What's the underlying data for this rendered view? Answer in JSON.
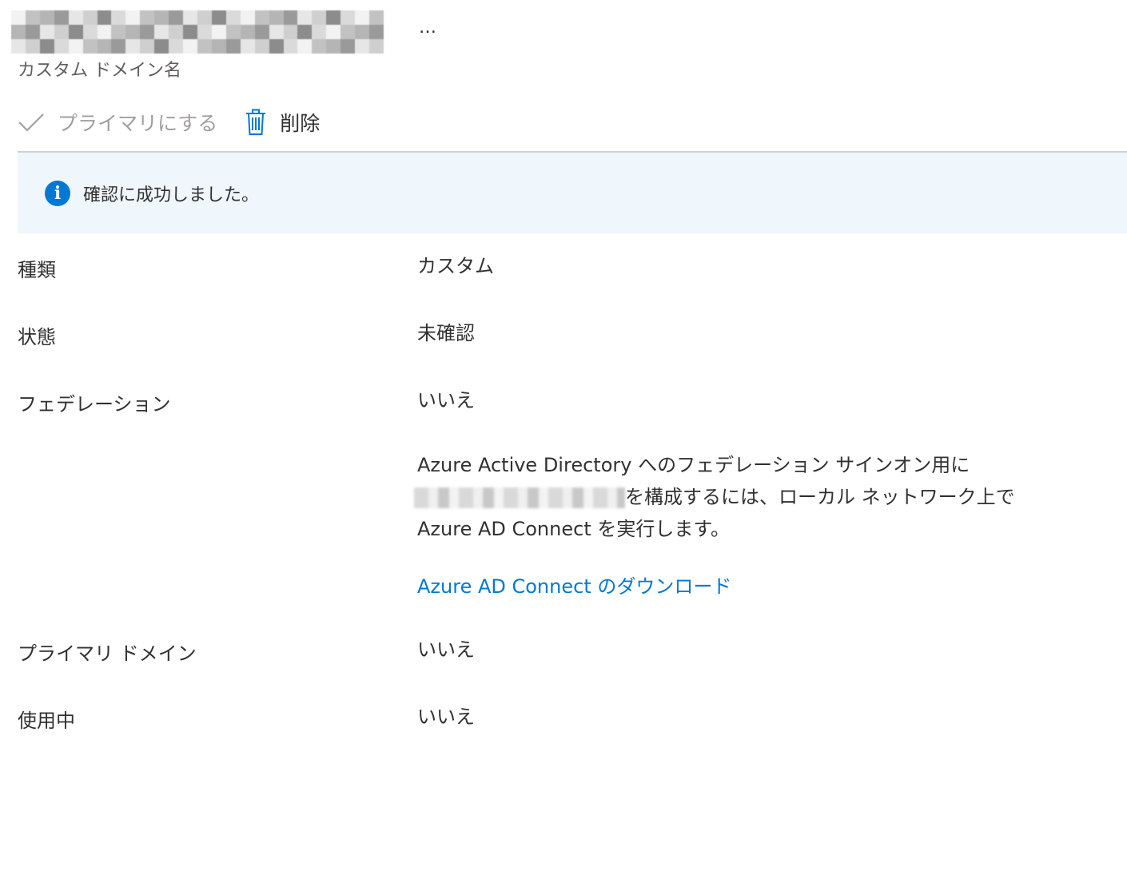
{
  "header": {
    "more_label": "…",
    "subtitle": "カスタム ドメイン名"
  },
  "toolbar": {
    "make_primary_label": "プライマリにする",
    "delete_label": "削除"
  },
  "infobar": {
    "message": "確認に成功しました。",
    "icon": "info-icon",
    "color": "#0078d4"
  },
  "properties": {
    "type": {
      "label": "種類",
      "value": "カスタム"
    },
    "status": {
      "label": "状態",
      "value": "未確認"
    },
    "federation": {
      "label": "フェデレーション",
      "value": "いいえ"
    },
    "primary_domain": {
      "label": "プライマリ ドメイン",
      "value": "いいえ"
    },
    "in_use": {
      "label": "使用中",
      "value": "いいえ"
    }
  },
  "federation_note": {
    "line1": "Azure Active Directory へのフェデレーション サインオン用に",
    "line2_after_redaction": "を構成するには、ローカル ネットワーク上で",
    "line3": "Azure AD Connect を実行します。",
    "link_label": "Azure AD Connect のダウンロード"
  },
  "colors": {
    "accent": "#0078d4",
    "infobar_bg": "#eff6fc",
    "text": "#323130",
    "disabled_text": "#a19f9d"
  }
}
